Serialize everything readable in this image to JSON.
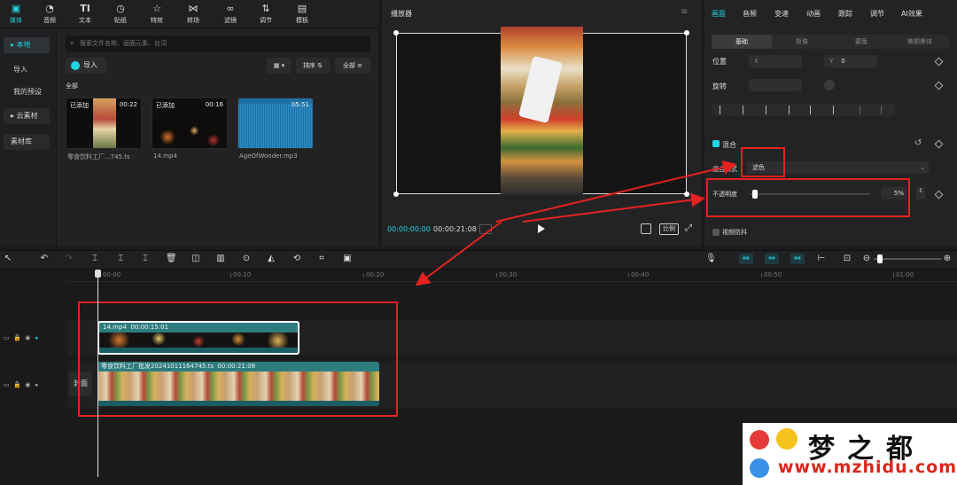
{
  "toolbar": {
    "items": [
      {
        "label": "媒体",
        "icon": "media-icon",
        "active": true
      },
      {
        "label": "音频",
        "icon": "audio-icon"
      },
      {
        "label": "文本",
        "icon": "text-icon"
      },
      {
        "label": "贴纸",
        "icon": "sticker-icon"
      },
      {
        "label": "特效",
        "icon": "effects-icon"
      },
      {
        "label": "转场",
        "icon": "transition-icon"
      },
      {
        "label": "滤镜",
        "icon": "filter-icon"
      },
      {
        "label": "调节",
        "icon": "adjust-icon"
      },
      {
        "label": "模板",
        "icon": "template-icon"
      }
    ]
  },
  "sidebar": {
    "items": [
      {
        "label": "本地",
        "active": true
      },
      {
        "label": "导入"
      },
      {
        "label": "我的预设"
      },
      {
        "label": "云素材"
      },
      {
        "label": "素材库"
      }
    ]
  },
  "media": {
    "search_placeholder": "搜索文件名称、画面元素、台词",
    "import_label": "导入",
    "sort_label": "排序",
    "filter_label": "全部",
    "section_label": "全部",
    "clips": [
      {
        "tag": "已添加",
        "duration": "00:22",
        "name": "零食饮料工厂...745.ts"
      },
      {
        "tag": "已添加",
        "duration": "00:16",
        "name": "14.mp4"
      },
      {
        "tag": "",
        "duration": "05:51",
        "name": "AgeOfWonder.mp3"
      }
    ]
  },
  "player": {
    "title": "播放器",
    "current_time": "00:00:00:00",
    "total_time": "00:00:21:08",
    "ratio_label": "比例"
  },
  "properties": {
    "tabs": [
      "画面",
      "音频",
      "变速",
      "动画",
      "跟踪",
      "调节",
      "AI效果"
    ],
    "subtabs": [
      "基础",
      "抠像",
      "蒙版",
      "美颜美体"
    ],
    "position_label": "位置",
    "x_label": "X",
    "y_label": "Y",
    "y_value": "0",
    "rotate_label": "旋转",
    "blend_label": "混合",
    "blend_mode_label": "混合模式",
    "blend_mode_value": "滤色",
    "opacity_label": "不透明度",
    "opacity_value": "5%",
    "stabilize_label": "视频防抖"
  },
  "timeline": {
    "ticks": [
      "00:00",
      "00:10",
      "00:20",
      "00:30",
      "00:40",
      "00:50",
      "01:00"
    ],
    "cover_label": "封面",
    "clip1": {
      "name": "14.mp4",
      "duration": "00:00:15:01"
    },
    "clip2": {
      "name": "零食饮料工厂批发20241011164745.ts",
      "duration": "00:00:21:08"
    }
  },
  "watermark": {
    "title": "梦之都",
    "url": "www.mzhidu.com"
  },
  "colors": {
    "accent": "#22d3e0",
    "annotation": "#e52121"
  }
}
